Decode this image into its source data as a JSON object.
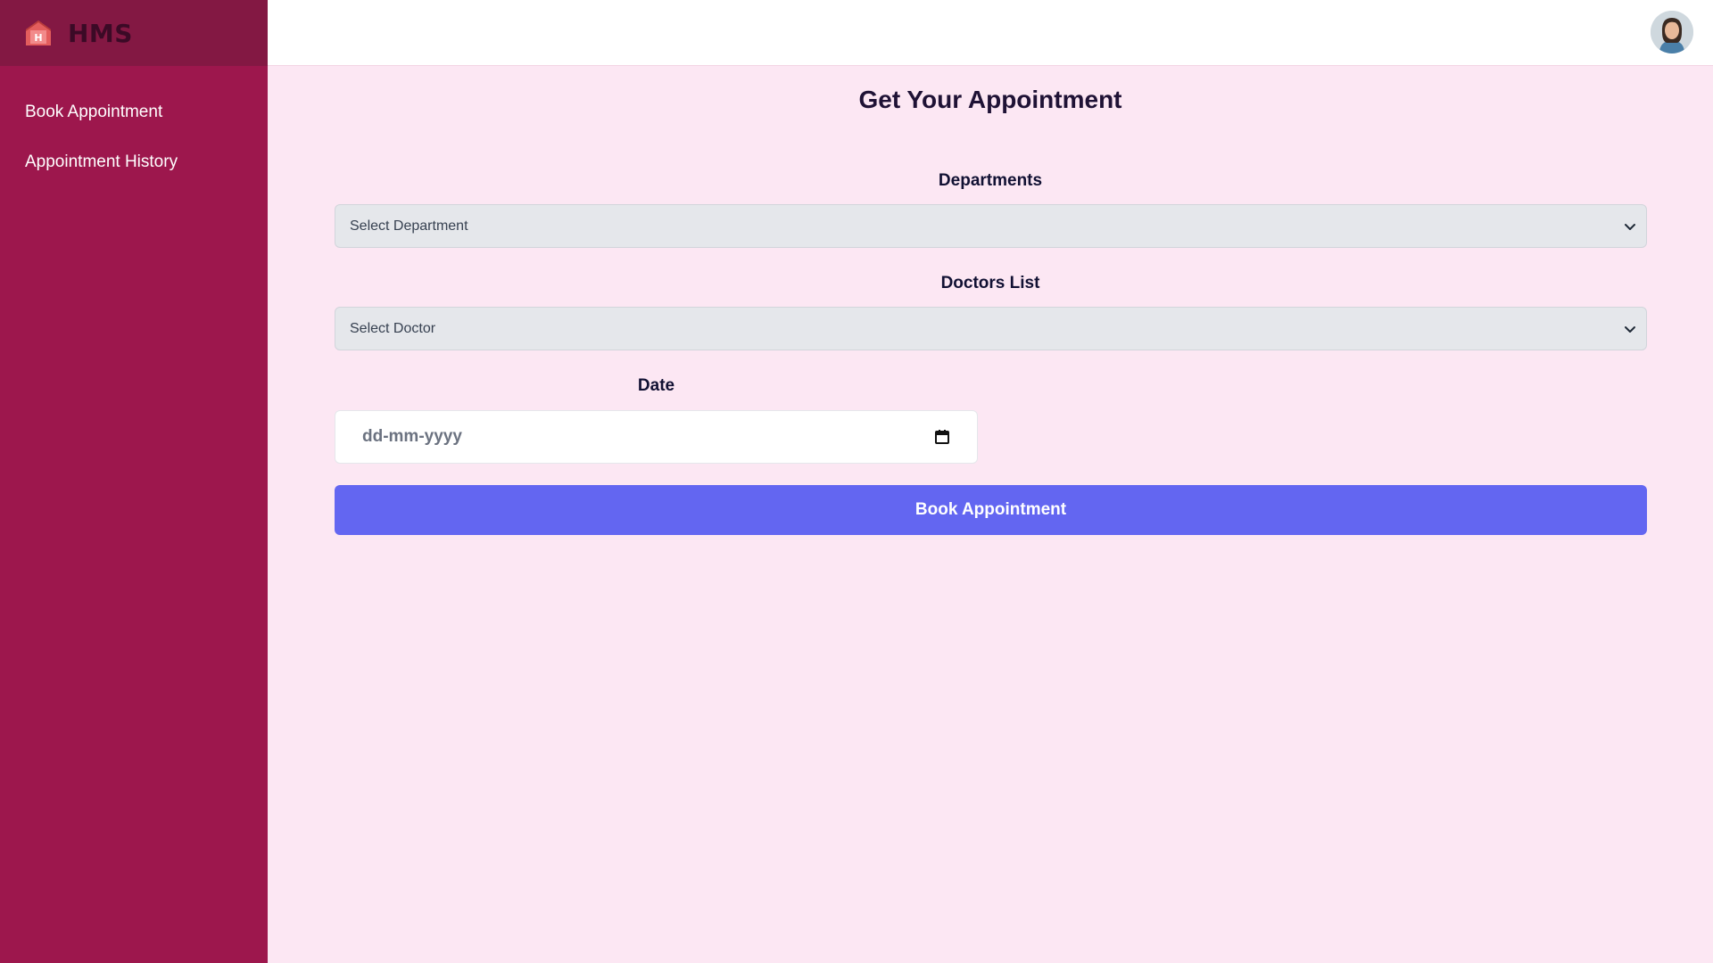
{
  "brand": {
    "name": "HMS",
    "logo_letter": "H",
    "logo_color": "#e35d5d"
  },
  "sidebar": {
    "background": "#9d174d",
    "items": [
      {
        "label": "Book Appointment"
      },
      {
        "label": "Appointment History"
      }
    ]
  },
  "header": {
    "avatar_icon": "user-avatar"
  },
  "main": {
    "title": "Get Your Appointment",
    "departments": {
      "label": "Departments",
      "value": "Select Department"
    },
    "doctors": {
      "label": "Doctors List",
      "value": "Select Doctor"
    },
    "date": {
      "label": "Date",
      "placeholder": "dd-mm-yyyy"
    },
    "submit_label": "Book Appointment",
    "accent": "#6366f1"
  }
}
